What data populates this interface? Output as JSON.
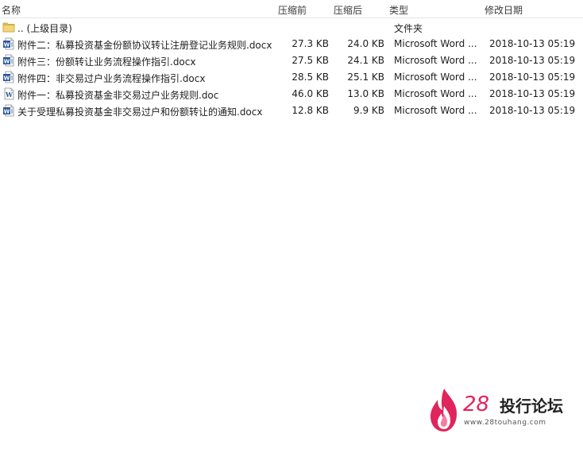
{
  "columns": {
    "name": "名称",
    "size_before": "压缩前",
    "size_after": "压缩后",
    "type": "类型",
    "modified": "修改日期"
  },
  "parent_row": {
    "name": ".. (上级目录)",
    "type": "文件夹"
  },
  "files": [
    {
      "name": "附件二：私募投资基金份额协议转让注册登记业务规则.docx",
      "size_before": "27.3 KB",
      "size_after": "24.0 KB",
      "type": "Microsoft Word ...",
      "modified": "2018-10-13 05:19",
      "icon": "word-docx-icon"
    },
    {
      "name": "附件三：份额转让业务流程操作指引.docx",
      "size_before": "27.5 KB",
      "size_after": "24.1 KB",
      "type": "Microsoft Word ...",
      "modified": "2018-10-13 05:19",
      "icon": "word-docx-icon"
    },
    {
      "name": "附件四：非交易过户业务流程操作指引.docx",
      "size_before": "28.5 KB",
      "size_after": "25.1 KB",
      "type": "Microsoft Word ...",
      "modified": "2018-10-13 05:19",
      "icon": "word-docx-icon"
    },
    {
      "name": "附件一：私募投资基金非交易过户业务规则.doc",
      "size_before": "46.0 KB",
      "size_after": "13.0 KB",
      "type": "Microsoft Word ...",
      "modified": "2018-10-13 05:19",
      "icon": "word-doc-icon"
    },
    {
      "name": "关于受理私募投资基金非交易过户和份额转让的通知.docx",
      "size_before": "12.8 KB",
      "size_after": "9.9 KB",
      "type": "Microsoft Word ...",
      "modified": "2018-10-13 05:19",
      "icon": "word-docx-icon"
    }
  ],
  "watermark": {
    "number": "28",
    "title": "投行论坛",
    "url": "www.28touhang.com"
  },
  "colors": {
    "word_blue": "#2b579a",
    "folder_yellow": "#e8c15a",
    "brand_pink": "#e0245c"
  }
}
